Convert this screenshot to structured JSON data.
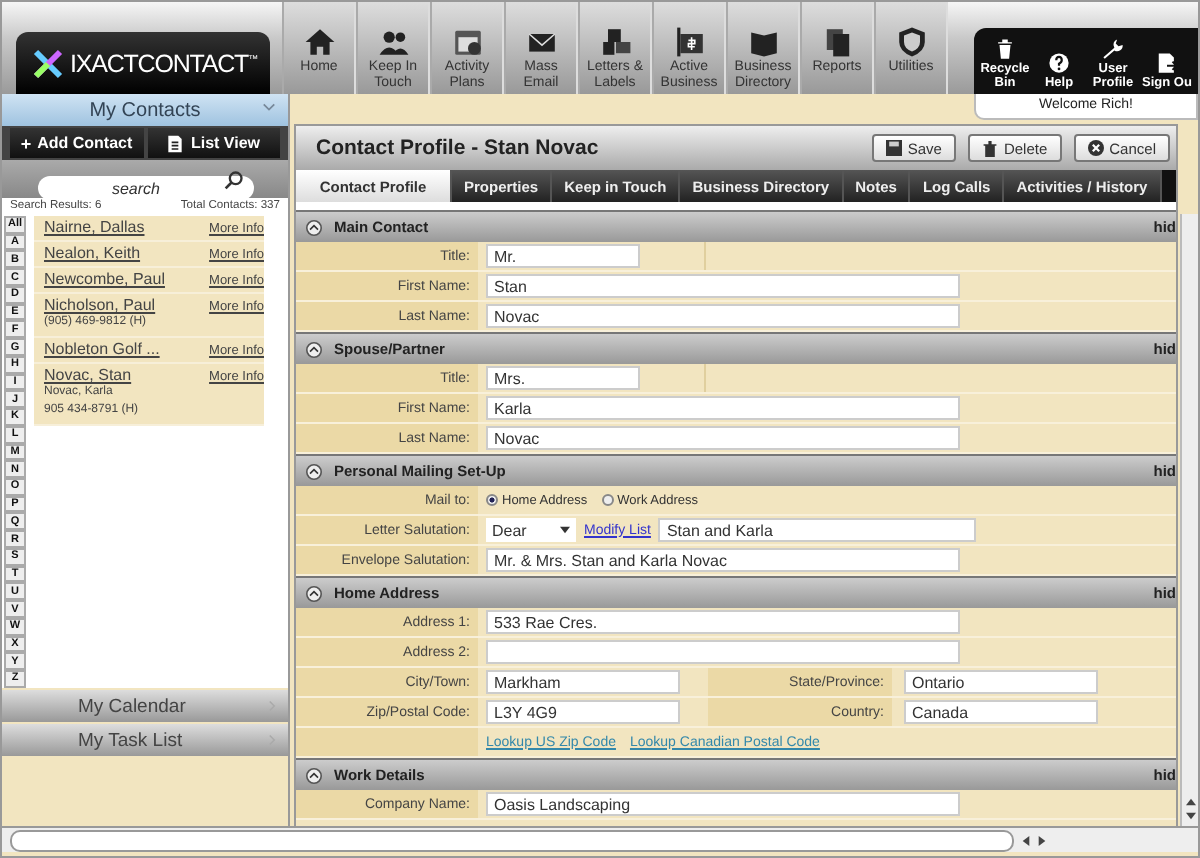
{
  "logo": {
    "text": "IXACTCONTACT",
    "mark": "™"
  },
  "nav": [
    {
      "label": "Home"
    },
    {
      "label": "Keep In Touch"
    },
    {
      "label": "Activity Plans"
    },
    {
      "label": "Mass Email"
    },
    {
      "label": "Letters & Labels"
    },
    {
      "label": "Active Business"
    },
    {
      "label": "Business Directory"
    },
    {
      "label": "Reports"
    },
    {
      "label": "Utilities"
    }
  ],
  "user_menu": [
    {
      "label": "Recycle Bin"
    },
    {
      "label": "Help"
    },
    {
      "label": "User Profile"
    },
    {
      "label": "Sign Ou"
    }
  ],
  "welcome": "Welcome Rich!",
  "sidebar": {
    "title": "My Contacts",
    "add_button": "Add Contact",
    "add_mark": "+",
    "list_button": "List View",
    "search": {
      "placeholder": "search"
    },
    "results": "Search Results: 6",
    "total": "Total Contacts: 337",
    "letters": [
      "All",
      "A",
      "B",
      "C",
      "D",
      "E",
      "F",
      "G",
      "H",
      "I",
      "J",
      "K",
      "L",
      "M",
      "N",
      "O",
      "P",
      "Q",
      "R",
      "S",
      "T",
      "U",
      "V",
      "W",
      "X",
      "Y",
      "Z"
    ],
    "contacts": [
      {
        "name": "Nairne, Dallas",
        "more": "More Info"
      },
      {
        "name": "Nealon, Keith",
        "more": "More Info"
      },
      {
        "name": "Newcombe, Paul",
        "more": "More Info"
      },
      {
        "name": "Nicholson, Paul",
        "more": "More Info",
        "details": [
          "(905) 469-9812 (H)"
        ]
      },
      {
        "name": "Nobleton Golf ...",
        "more": "More Info"
      },
      {
        "name": "Novac, Stan",
        "more": "More Info",
        "details": [
          "Novac, Karla",
          "905 434-8791 (H)"
        ]
      }
    ],
    "panels": [
      {
        "title": "My Calendar"
      },
      {
        "title": "My Task List"
      }
    ]
  },
  "profile": {
    "title": "Contact Profile - Stan Novac",
    "buttons": [
      {
        "kind": "save",
        "label": "Save"
      },
      {
        "kind": "delete",
        "label": "Delete"
      },
      {
        "kind": "cancel",
        "label": "Cancel"
      }
    ],
    "tabs": [
      {
        "label": "Contact Profile",
        "selected": true
      },
      {
        "label": "Properties",
        "selected": false
      },
      {
        "label": "Keep in Touch",
        "selected": false
      },
      {
        "label": "Business Directory",
        "selected": false
      },
      {
        "label": "Notes",
        "selected": false
      },
      {
        "label": "Log Calls",
        "selected": false
      },
      {
        "label": "Activities / History",
        "selected": false
      }
    ],
    "sections": [
      {
        "title": "Main Contact",
        "toggle": "hid",
        "rows": [
          {
            "kind": "short",
            "label": "Title:",
            "value": "Mr."
          },
          {
            "kind": "long",
            "label": "First Name:",
            "value": "Stan"
          },
          {
            "kind": "long",
            "label": "Last Name:",
            "value": "Novac"
          }
        ]
      },
      {
        "title": "Spouse/Partner",
        "toggle": "hid",
        "rows": [
          {
            "kind": "short",
            "label": "Title:",
            "value": "Mrs."
          },
          {
            "kind": "long",
            "label": "First Name:",
            "value": "Karla"
          },
          {
            "kind": "long",
            "label": "Last Name:",
            "value": "Novac"
          }
        ]
      },
      {
        "title": "Personal Mailing Set-Up",
        "toggle": "hid",
        "rows": [
          {
            "kind": "radio",
            "label": "Mail to:",
            "options": [
              {
                "label": "Home Address",
                "selected": true
              },
              {
                "label": "Work Address",
                "selected": false
              }
            ]
          },
          {
            "kind": "salutation",
            "label": "Letter Salutation:",
            "choice": "Dear",
            "link": "Modify List",
            "value": "Stan and Karla"
          },
          {
            "kind": "long",
            "label": "Envelope Salutation:",
            "value": "Mr. & Mrs. Stan and Karla Novac"
          }
        ]
      },
      {
        "title": "Home Address",
        "toggle": "hid",
        "rows": [
          {
            "kind": "long",
            "label": "Address 1:",
            "value": "533 Rae Cres."
          },
          {
            "kind": "long",
            "label": "Address 2:"
          },
          {
            "kind": "pair",
            "label": "City/Town:",
            "value": "Markham",
            "label2": "State/Province:",
            "value2": "Ontario"
          },
          {
            "kind": "pair",
            "label": "Zip/Postal Code:",
            "value": "L3Y 4G9",
            "label2": "Country:",
            "value2": "Canada"
          },
          {
            "kind": "links",
            "links": [
              "Lookup US Zip Code",
              "Lookup Canadian Postal Code"
            ]
          }
        ]
      },
      {
        "title": "Work Details",
        "toggle": "hid",
        "rows": [
          {
            "kind": "long",
            "label": "Company Name:",
            "value": "Oasis Landscaping"
          }
        ]
      }
    ]
  }
}
